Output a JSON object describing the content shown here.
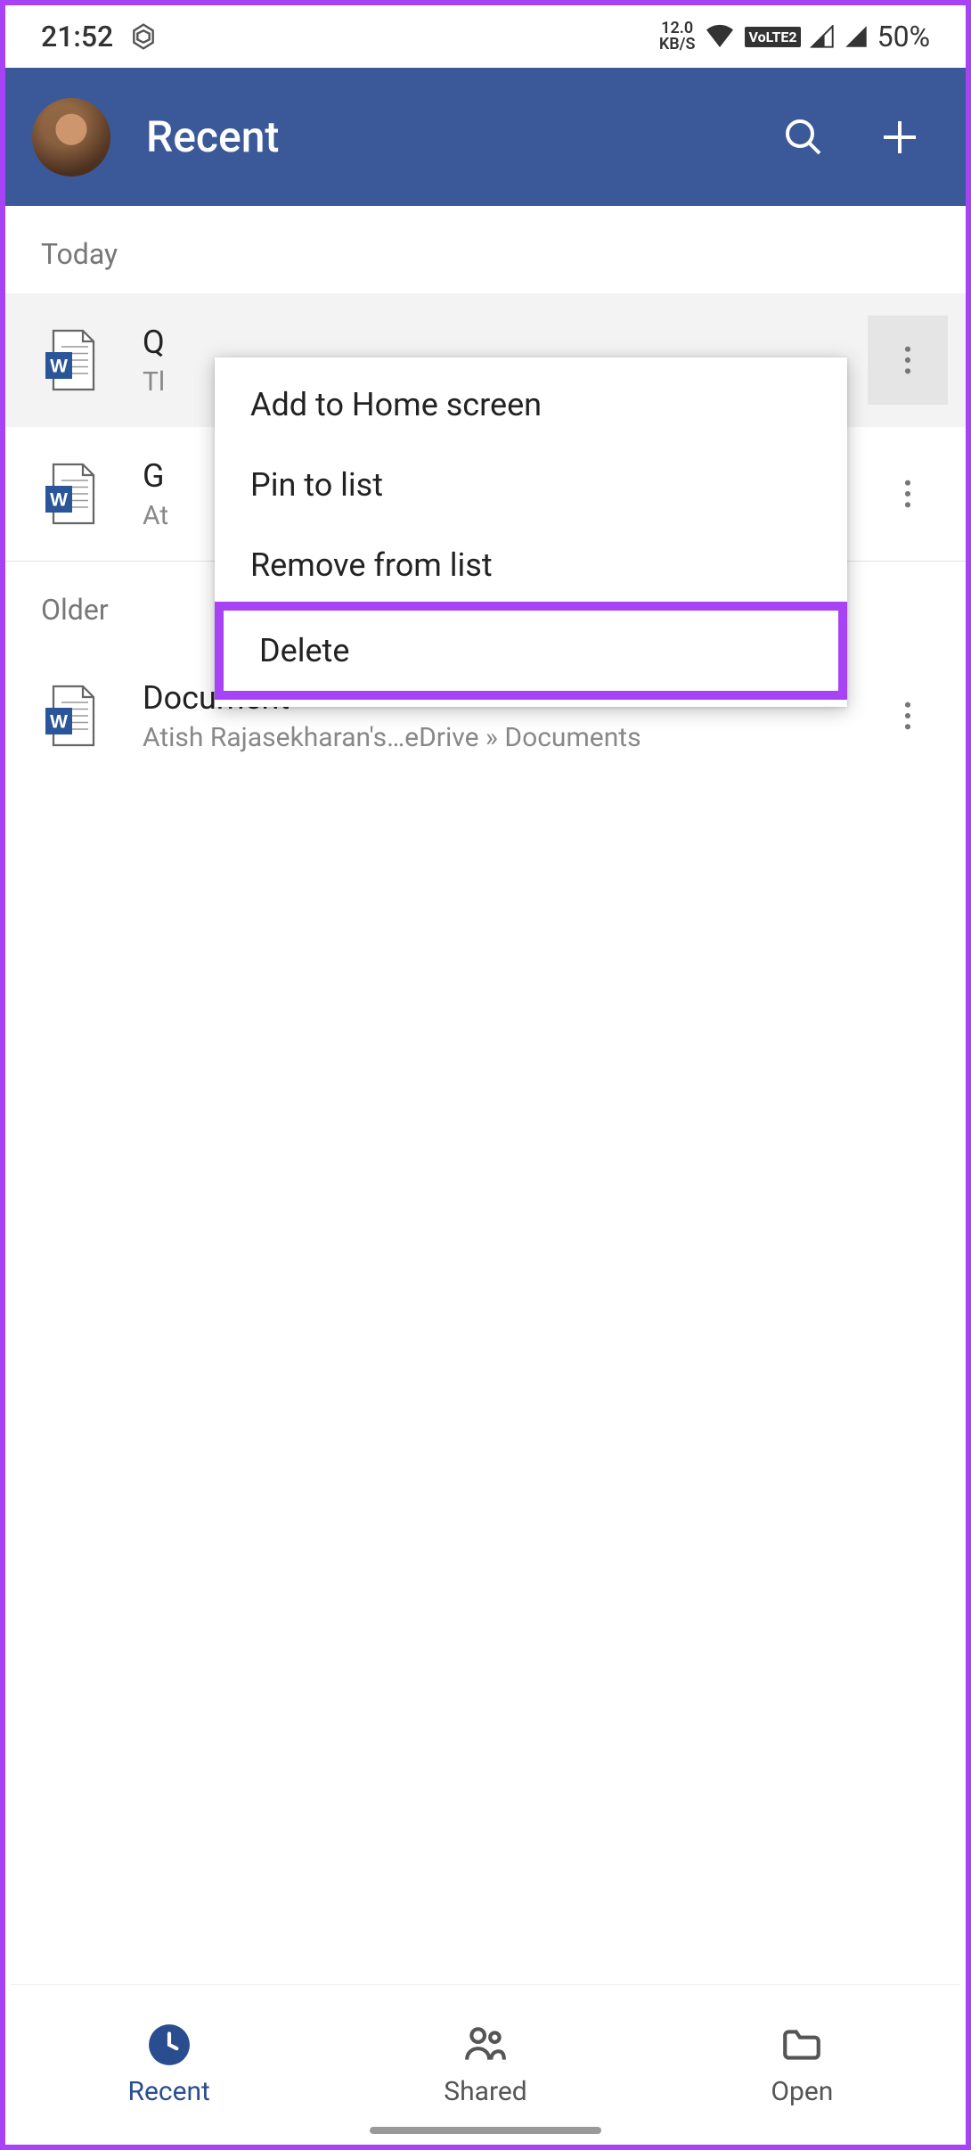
{
  "status": {
    "time": "21:52",
    "net_speed_top": "12.0",
    "net_speed_bottom": "KB/S",
    "volte": "VoLTE2",
    "battery": "50%"
  },
  "header": {
    "title": "Recent"
  },
  "sections": {
    "today": "Today",
    "older": "Older"
  },
  "files": {
    "f1": {
      "title": "Q",
      "sub": "Tl"
    },
    "f2": {
      "title": "G",
      "sub": "At"
    },
    "f3": {
      "title": "Document",
      "sub": "Atish Rajasekharan's…eDrive » Documents"
    }
  },
  "menu": {
    "add_home": "Add to Home screen",
    "pin": "Pin to list",
    "remove": "Remove from list",
    "delete": "Delete"
  },
  "nav": {
    "recent": "Recent",
    "shared": "Shared",
    "open": "Open"
  }
}
